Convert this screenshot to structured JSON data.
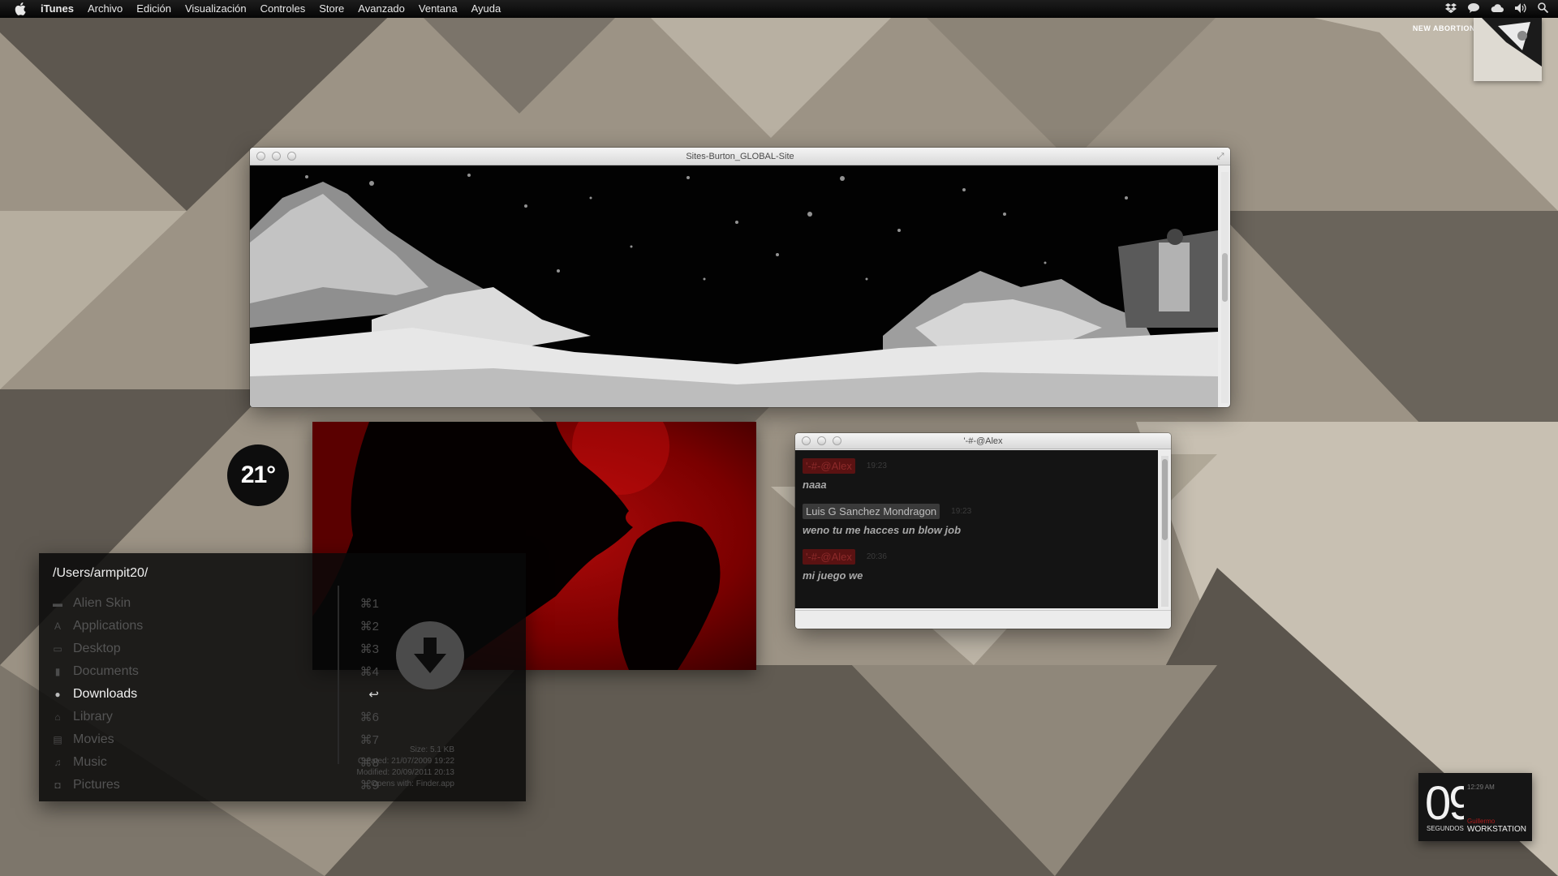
{
  "menubar": {
    "app_name": "iTunes",
    "items": [
      "Archivo",
      "Edición",
      "Visualización",
      "Controles",
      "Store",
      "Avanzado",
      "Ventana",
      "Ayuda"
    ]
  },
  "top_widget": {
    "label": "NEW ABORTION"
  },
  "browser_window": {
    "title": "Sites-Burton_GLOBAL-Site"
  },
  "weather": {
    "temperature": "21°"
  },
  "chat": {
    "title": "'-#-@Alex",
    "messages": [
      {
        "name": "'-#-@Alex",
        "time": "19:23",
        "text": "naaa",
        "style": "red"
      },
      {
        "name": "Luis G Sanchez Mondragon",
        "time": "19:23",
        "text": "weno tu me hacces un blow job",
        "style": "gray"
      },
      {
        "name": "'-#-@Alex",
        "time": "20:36",
        "text": "mi juego we",
        "style": "red"
      }
    ]
  },
  "finder": {
    "path": "/Users/armpit20/",
    "items": [
      {
        "label": "Alien Skin",
        "shortcut": "⌘1",
        "icon": "folder-icon",
        "selected": false
      },
      {
        "label": "Applications",
        "shortcut": "⌘2",
        "icon": "applications-icon",
        "selected": false
      },
      {
        "label": "Desktop",
        "shortcut": "⌘3",
        "icon": "desktop-icon",
        "selected": false
      },
      {
        "label": "Documents",
        "shortcut": "⌘4",
        "icon": "documents-icon",
        "selected": false
      },
      {
        "label": "Downloads",
        "shortcut": "↩",
        "icon": "downloads-icon",
        "selected": true
      },
      {
        "label": "Library",
        "shortcut": "⌘6",
        "icon": "library-icon",
        "selected": false
      },
      {
        "label": "Movies",
        "shortcut": "⌘7",
        "icon": "movies-icon",
        "selected": false
      },
      {
        "label": "Music",
        "shortcut": "⌘8",
        "icon": "music-icon",
        "selected": false
      },
      {
        "label": "Pictures",
        "shortcut": "⌘9",
        "icon": "pictures-icon",
        "selected": false
      }
    ],
    "info": {
      "size": "Size: 5.1 KB",
      "created": "Created: 21/07/2009 19:22",
      "modified": "Modified: 20/09/2011 20:13",
      "opens_with": "Opens with: Finder.app"
    }
  },
  "clock": {
    "seconds": "09",
    "seconds_label": "SEGUNDOS",
    "time": "12:29 AM",
    "user": "Guillermo",
    "machine": "WORKSTATION"
  }
}
